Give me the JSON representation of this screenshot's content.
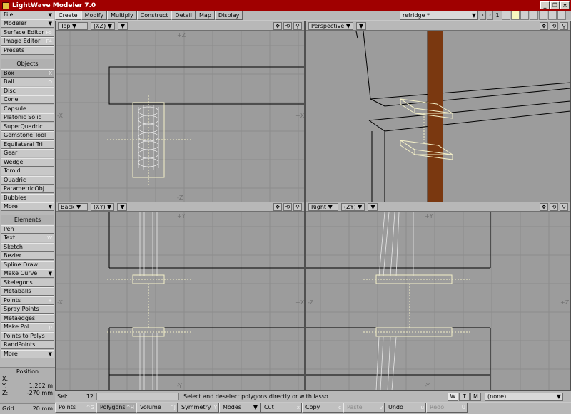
{
  "window": {
    "title": "LightWave Modeler 7.0"
  },
  "left_toolbar": {
    "top_items": [
      {
        "label": "File",
        "dropdown": true
      },
      {
        "label": "Modeler",
        "dropdown": true
      },
      {
        "label": "Surface Editor",
        "shortcut": "F5"
      },
      {
        "label": "Image Editor",
        "shortcut": "F4"
      },
      {
        "label": "Presets"
      }
    ],
    "objects_header": "Objects",
    "objects": [
      {
        "label": "Box",
        "shortcut": "X",
        "active": true
      },
      {
        "label": "Ball",
        "shortcut": "O"
      },
      {
        "label": "Disc"
      },
      {
        "label": "Cone"
      },
      {
        "label": "Capsule"
      },
      {
        "label": "Platonic Solid"
      },
      {
        "label": "SuperQuadric"
      },
      {
        "label": "Gemstone Tool"
      },
      {
        "label": "Equilateral Tri"
      },
      {
        "label": "Gear"
      },
      {
        "label": "Wedge"
      },
      {
        "label": "Toroid"
      },
      {
        "label": "Quadric"
      },
      {
        "label": "ParametricObj"
      },
      {
        "label": "Bubbles"
      },
      {
        "label": "More",
        "dropdown": true
      }
    ],
    "elements_header": "Elements",
    "elements": [
      {
        "label": "Pen"
      },
      {
        "label": "Text",
        "shortcut": "W"
      },
      {
        "label": "Sketch"
      },
      {
        "label": "Bezier"
      },
      {
        "label": "Spline Draw"
      },
      {
        "label": "Make Curve",
        "dropdown": true
      },
      {
        "label": "Skelegons"
      },
      {
        "label": "Metaballs"
      },
      {
        "label": "Points",
        "shortcut": "+"
      },
      {
        "label": "Spray Points"
      },
      {
        "label": "Metaedges"
      },
      {
        "label": "Make Pol",
        "shortcut": "p"
      },
      {
        "label": "Points to Polys"
      },
      {
        "label": "RandPoints"
      },
      {
        "label": "More",
        "dropdown": true
      }
    ],
    "position": {
      "title": "Position",
      "x_label": "X:",
      "x_value": "",
      "y_label": "Y:",
      "y_value": "1.262 m",
      "z_label": "Z:",
      "z_value": "-270 mm"
    },
    "grid": {
      "label": "Grid:",
      "value": "20 mm"
    }
  },
  "tabs": [
    {
      "label": "Create",
      "active": true
    },
    {
      "label": "Modify"
    },
    {
      "label": "Multiply"
    },
    {
      "label": "Construct"
    },
    {
      "label": "Detail"
    },
    {
      "label": "Map"
    },
    {
      "label": "Display"
    }
  ],
  "object_selector": {
    "value": "refridge *"
  },
  "layers": {
    "current": "1"
  },
  "viewports": {
    "top": {
      "view": "Top",
      "axes": "(XZ)",
      "labels": {
        "top": "+Z",
        "bottom": "-Z",
        "left": "-X",
        "right": "+X"
      }
    },
    "perspective": {
      "view": "Perspective"
    },
    "back": {
      "view": "Back",
      "axes": "(XY)",
      "labels": {
        "top": "+Y",
        "bottom": "-Y",
        "left": "-X",
        "right": "+X"
      }
    },
    "right": {
      "view": "Right",
      "axes": "(ZY)",
      "labels": {
        "top": "+Y",
        "bottom": "-Y",
        "left": "-Z",
        "right": "+Z"
      }
    },
    "control_icons": [
      "move-view-icon",
      "rotate-view-icon",
      "zoom-view-icon"
    ]
  },
  "info_bar": {
    "sel_label": "Sel:",
    "sel_count": "12",
    "message": "Select and deselect polygons directly or with lasso.",
    "w": "W",
    "t": "T",
    "m": "M",
    "surface": "(none)"
  },
  "mode_bar": {
    "points": {
      "label": "Points",
      "shortcut": "^G"
    },
    "polygons": {
      "label": "Polygons",
      "shortcut": "^H"
    },
    "volume": {
      "label": "Volume",
      "shortcut": "^J"
    },
    "symmetry": {
      "label": "Symmetry",
      "shortcut": "Y"
    },
    "modes": {
      "label": "Modes"
    },
    "cut": {
      "label": "Cut",
      "shortcut": "x"
    },
    "copy": {
      "label": "Copy",
      "shortcut": "c"
    },
    "paste": {
      "label": "Paste",
      "shortcut": "v"
    },
    "undo": {
      "label": "Undo",
      "shortcut": "u"
    },
    "redo": {
      "label": "Redo",
      "shortcut": "U"
    }
  },
  "colors": {
    "titlebar": "#a00000",
    "viewport_bg": "#9c9c9c",
    "selected": "#f0f0c0",
    "wood": "#7a3810"
  }
}
